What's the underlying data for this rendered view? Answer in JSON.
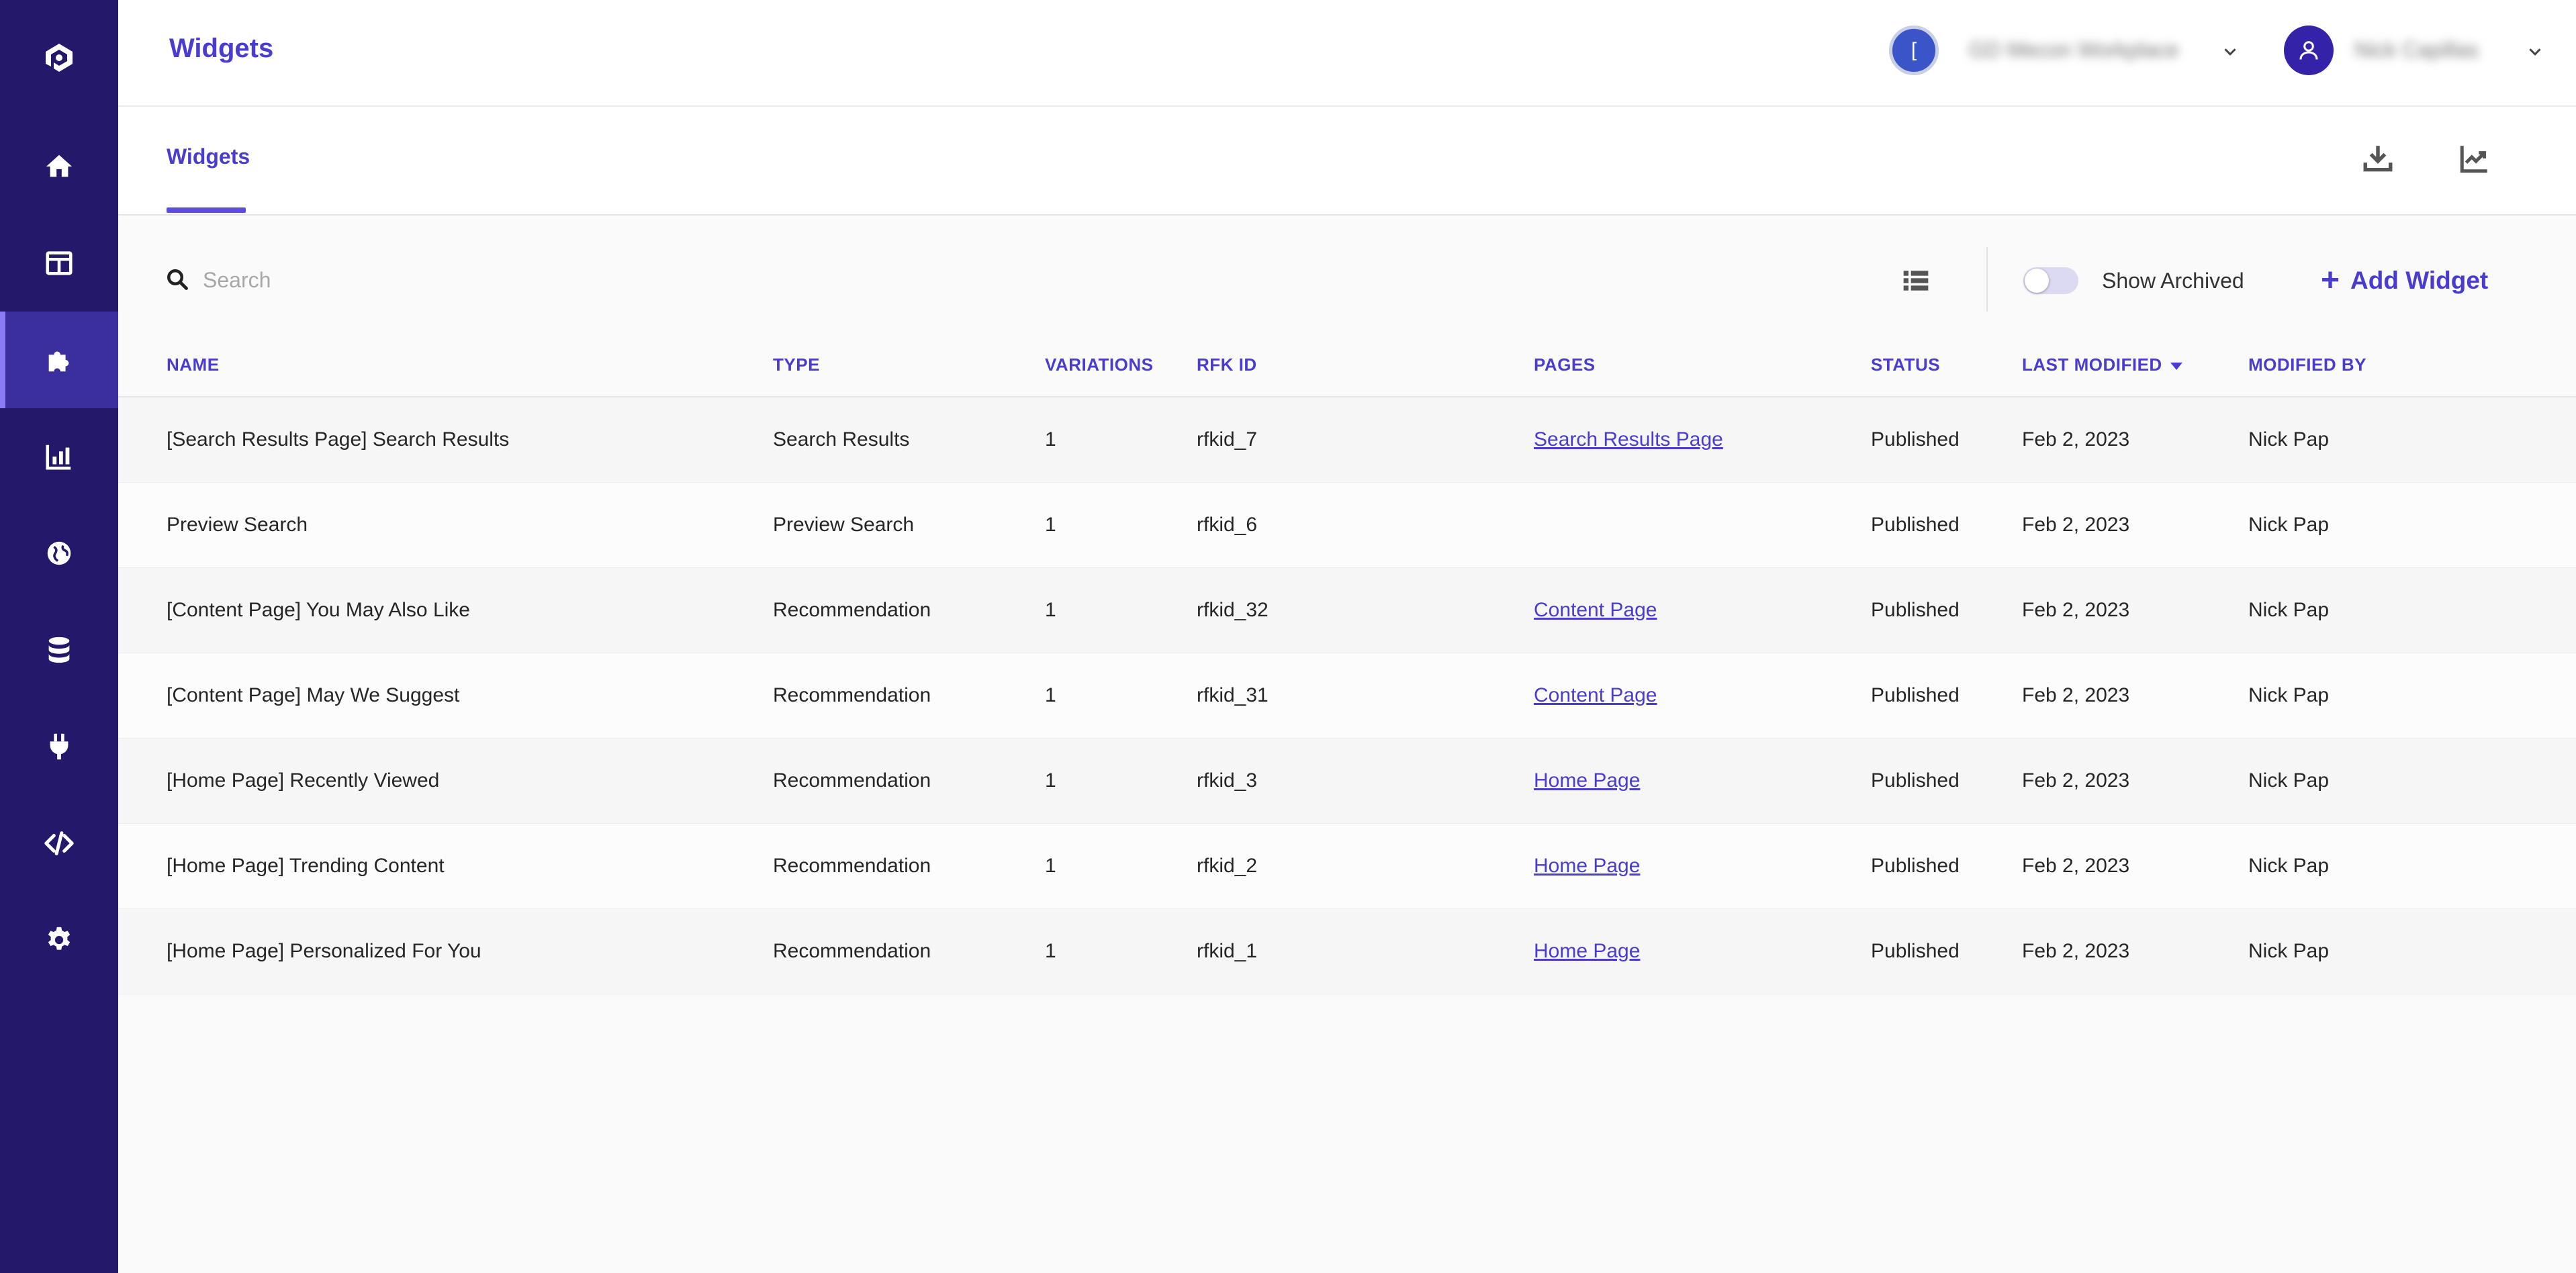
{
  "colors": {
    "sidebar": "#24186a",
    "sidebar_active": "#3b2fa0",
    "accent": "#4a3ccf"
  },
  "header": {
    "title": "Widgets",
    "org_initial": "[",
    "org_name": "GD Mecon Workplace",
    "user_name": "Nick Capillas"
  },
  "sidebar": {
    "items": [
      {
        "icon": "home-icon"
      },
      {
        "icon": "layout-icon"
      },
      {
        "icon": "puzzle-icon",
        "active": true
      },
      {
        "icon": "bar-chart-icon"
      },
      {
        "icon": "globe-icon"
      },
      {
        "icon": "database-icon"
      },
      {
        "icon": "plug-icon"
      },
      {
        "icon": "code-icon"
      },
      {
        "icon": "gear-icon"
      }
    ]
  },
  "tabs": [
    {
      "label": "Widgets",
      "active": true
    }
  ],
  "toolbar": {
    "search_placeholder": "Search",
    "show_archived_label": "Show Archived",
    "show_archived": false,
    "add_label": "Add Widget"
  },
  "table": {
    "columns": {
      "name": "NAME",
      "type": "TYPE",
      "variations": "VARIATIONS",
      "rfk_id": "RFK ID",
      "pages": "PAGES",
      "status": "STATUS",
      "last_modified": "LAST MODIFIED",
      "modified_by": "MODIFIED BY"
    },
    "rows": [
      {
        "name": "[Search Results Page] Search Results",
        "type": "Search Results",
        "variations": "1",
        "rfk_id": "rfkid_7",
        "pages": "Search Results Page",
        "status": "Published",
        "last_modified": "Feb 2, 2023",
        "modified_by": "Nick Pap"
      },
      {
        "name": "Preview Search",
        "type": "Preview Search",
        "variations": "1",
        "rfk_id": "rfkid_6",
        "pages": "",
        "status": "Published",
        "last_modified": "Feb 2, 2023",
        "modified_by": "Nick Pap"
      },
      {
        "name": "[Content Page] You May Also Like",
        "type": "Recommendation",
        "variations": "1",
        "rfk_id": "rfkid_32",
        "pages": "Content Page",
        "status": "Published",
        "last_modified": "Feb 2, 2023",
        "modified_by": "Nick Pap"
      },
      {
        "name": "[Content Page] May We Suggest",
        "type": "Recommendation",
        "variations": "1",
        "rfk_id": "rfkid_31",
        "pages": "Content Page",
        "status": "Published",
        "last_modified": "Feb 2, 2023",
        "modified_by": "Nick Pap"
      },
      {
        "name": "[Home Page] Recently Viewed",
        "type": "Recommendation",
        "variations": "1",
        "rfk_id": "rfkid_3",
        "pages": "Home Page",
        "status": "Published",
        "last_modified": "Feb 2, 2023",
        "modified_by": "Nick Pap"
      },
      {
        "name": "[Home Page] Trending Content",
        "type": "Recommendation",
        "variations": "1",
        "rfk_id": "rfkid_2",
        "pages": "Home Page",
        "status": "Published",
        "last_modified": "Feb 2, 2023",
        "modified_by": "Nick Pap"
      },
      {
        "name": "[Home Page] Personalized For You",
        "type": "Recommendation",
        "variations": "1",
        "rfk_id": "rfkid_1",
        "pages": "Home Page",
        "status": "Published",
        "last_modified": "Feb 2, 2023",
        "modified_by": "Nick Pap"
      }
    ]
  }
}
